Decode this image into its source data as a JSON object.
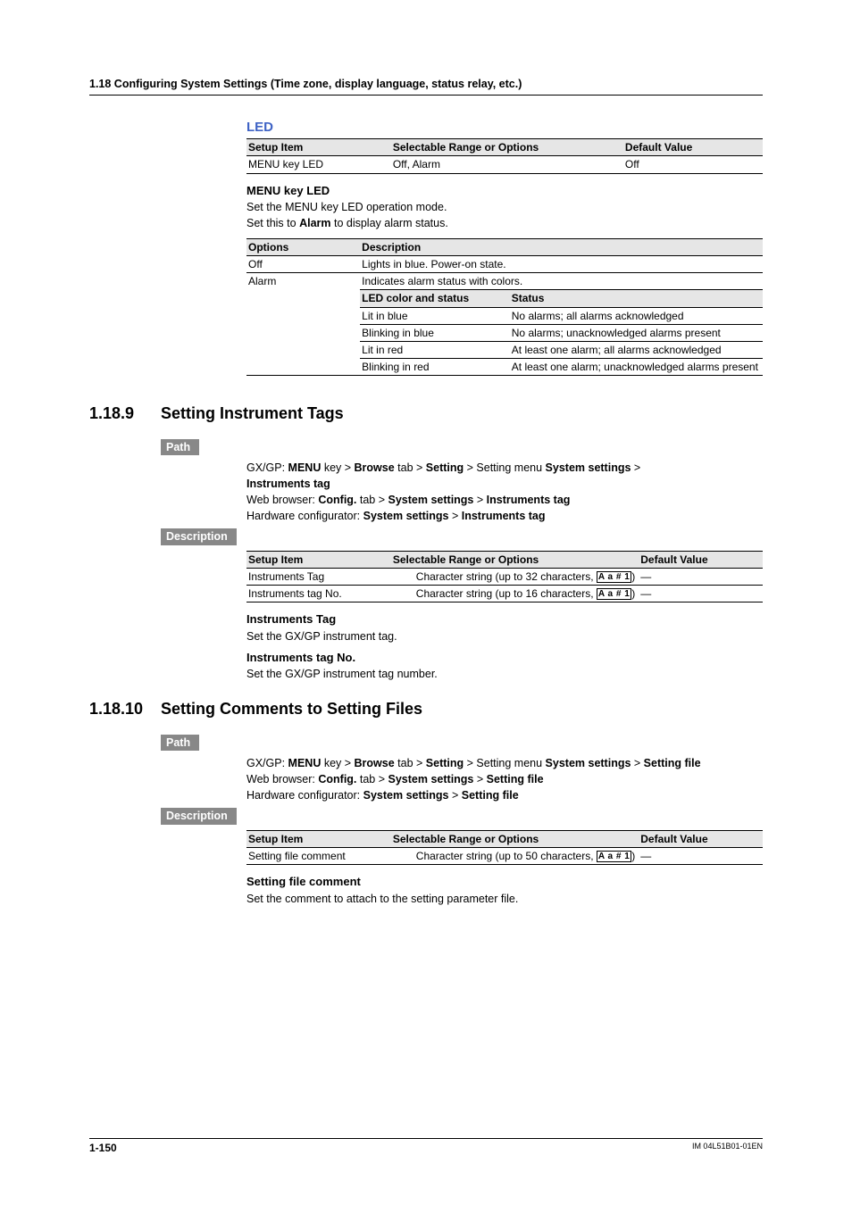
{
  "header": "1.18  Configuring System Settings (Time zone, display language, status relay, etc.)",
  "led": {
    "title": "LED",
    "table_headers": {
      "c1": "Setup Item",
      "c2": "Selectable Range or Options",
      "c3": "Default Value"
    },
    "row": {
      "item": "MENU key LED",
      "range": "Off, Alarm",
      "def": "Off"
    },
    "menu_h": "MENU key LED",
    "menu_p1": "Set the MENU key LED operation mode.",
    "menu_p2_a": "Set this to ",
    "menu_p2_b": "Alarm",
    "menu_p2_c": " to display alarm status.",
    "opts_headers": {
      "c1": "Options",
      "c2": "Description"
    },
    "opts_rows": [
      {
        "opt": "Off",
        "desc": "Lights in blue. Power-on state."
      },
      {
        "opt": "Alarm",
        "desc": "Indicates alarm status with colors."
      }
    ],
    "inner_headers": {
      "c1": "LED color and status",
      "c2": "Status"
    },
    "inner_rows": [
      {
        "c1": "Lit in blue",
        "c2": "No alarms; all alarms acknowledged"
      },
      {
        "c1": "Blinking in blue",
        "c2": "No alarms; unacknowledged alarms present"
      },
      {
        "c1": "Lit in red",
        "c2": "At least one alarm; all alarms acknowledged"
      },
      {
        "c1": "Blinking in red",
        "c2": "At least one alarm; unacknowledged alarms present"
      }
    ]
  },
  "sec189": {
    "num": "1.18.9",
    "title": "Setting Instrument Tags",
    "path_label": "Path",
    "path_gx_a": "GX/GP: ",
    "path_gx_b": "MENU",
    "path_gx_c": " key > ",
    "path_gx_d": "Browse",
    "path_gx_e": " tab > ",
    "path_gx_f": "Setting",
    "path_gx_g": " > Setting menu ",
    "path_gx_h": "System settings",
    "path_gx_i": " > ",
    "path_gx_line2": "Instruments tag",
    "path_web_a": "Web browser: ",
    "path_web_b": "Config.",
    "path_web_c": " tab > ",
    "path_web_d": "System settings",
    "path_web_e": " > ",
    "path_web_f": "Instruments tag",
    "path_hw_a": "Hardware configurator: ",
    "path_hw_b": "System settings",
    "path_hw_c": " > ",
    "path_hw_d": "Instruments tag",
    "desc_label": "Description",
    "tbl_h": {
      "c1": "Setup Item",
      "c2": "Selectable Range or Options",
      "c3": "Default Value"
    },
    "rows": [
      {
        "item": "Instruments Tag",
        "range_a": "Character string (up to 32 characters, ",
        "range_b": ")",
        "def": "―"
      },
      {
        "item": "Instruments tag No.",
        "range_a": "Character string (up to 16 characters, ",
        "range_b": ")",
        "def": "―"
      }
    ],
    "h1": "Instruments Tag",
    "p1": "Set the GX/GP instrument tag.",
    "h2": "Instruments tag No.",
    "p2": "Set the GX/GP instrument tag number."
  },
  "sec1810": {
    "num": "1.18.10",
    "title": "Setting Comments to Setting Files",
    "path_label": "Path",
    "path_gx_a": "GX/GP: ",
    "path_gx_b": "MENU",
    "path_gx_c": " key > ",
    "path_gx_d": "Browse",
    "path_gx_e": " tab > ",
    "path_gx_f": "Setting",
    "path_gx_g": " > Setting menu ",
    "path_gx_h": "System settings",
    "path_gx_i": " > ",
    "path_gx_j": "Setting file",
    "path_web_a": "Web browser: ",
    "path_web_b": "Config.",
    "path_web_c": " tab > ",
    "path_web_d": "System settings",
    "path_web_e": " > ",
    "path_web_f": "Setting file",
    "path_hw_a": "Hardware configurator: ",
    "path_hw_b": "System settings",
    "path_hw_c": " > ",
    "path_hw_d": "Setting file",
    "desc_label": "Description",
    "tbl_h": {
      "c1": "Setup Item",
      "c2": "Selectable Range or Options",
      "c3": "Default Value"
    },
    "row": {
      "item": "Setting file comment",
      "range_a": "Character string (up to 50 characters, ",
      "range_b": ")",
      "def": "―"
    },
    "h1": "Setting file comment",
    "p1": "Set the comment to attach to the setting parameter file."
  },
  "aabox": "A a # 1",
  "footer": {
    "page": "1-150",
    "docid": "IM 04L51B01-01EN"
  }
}
